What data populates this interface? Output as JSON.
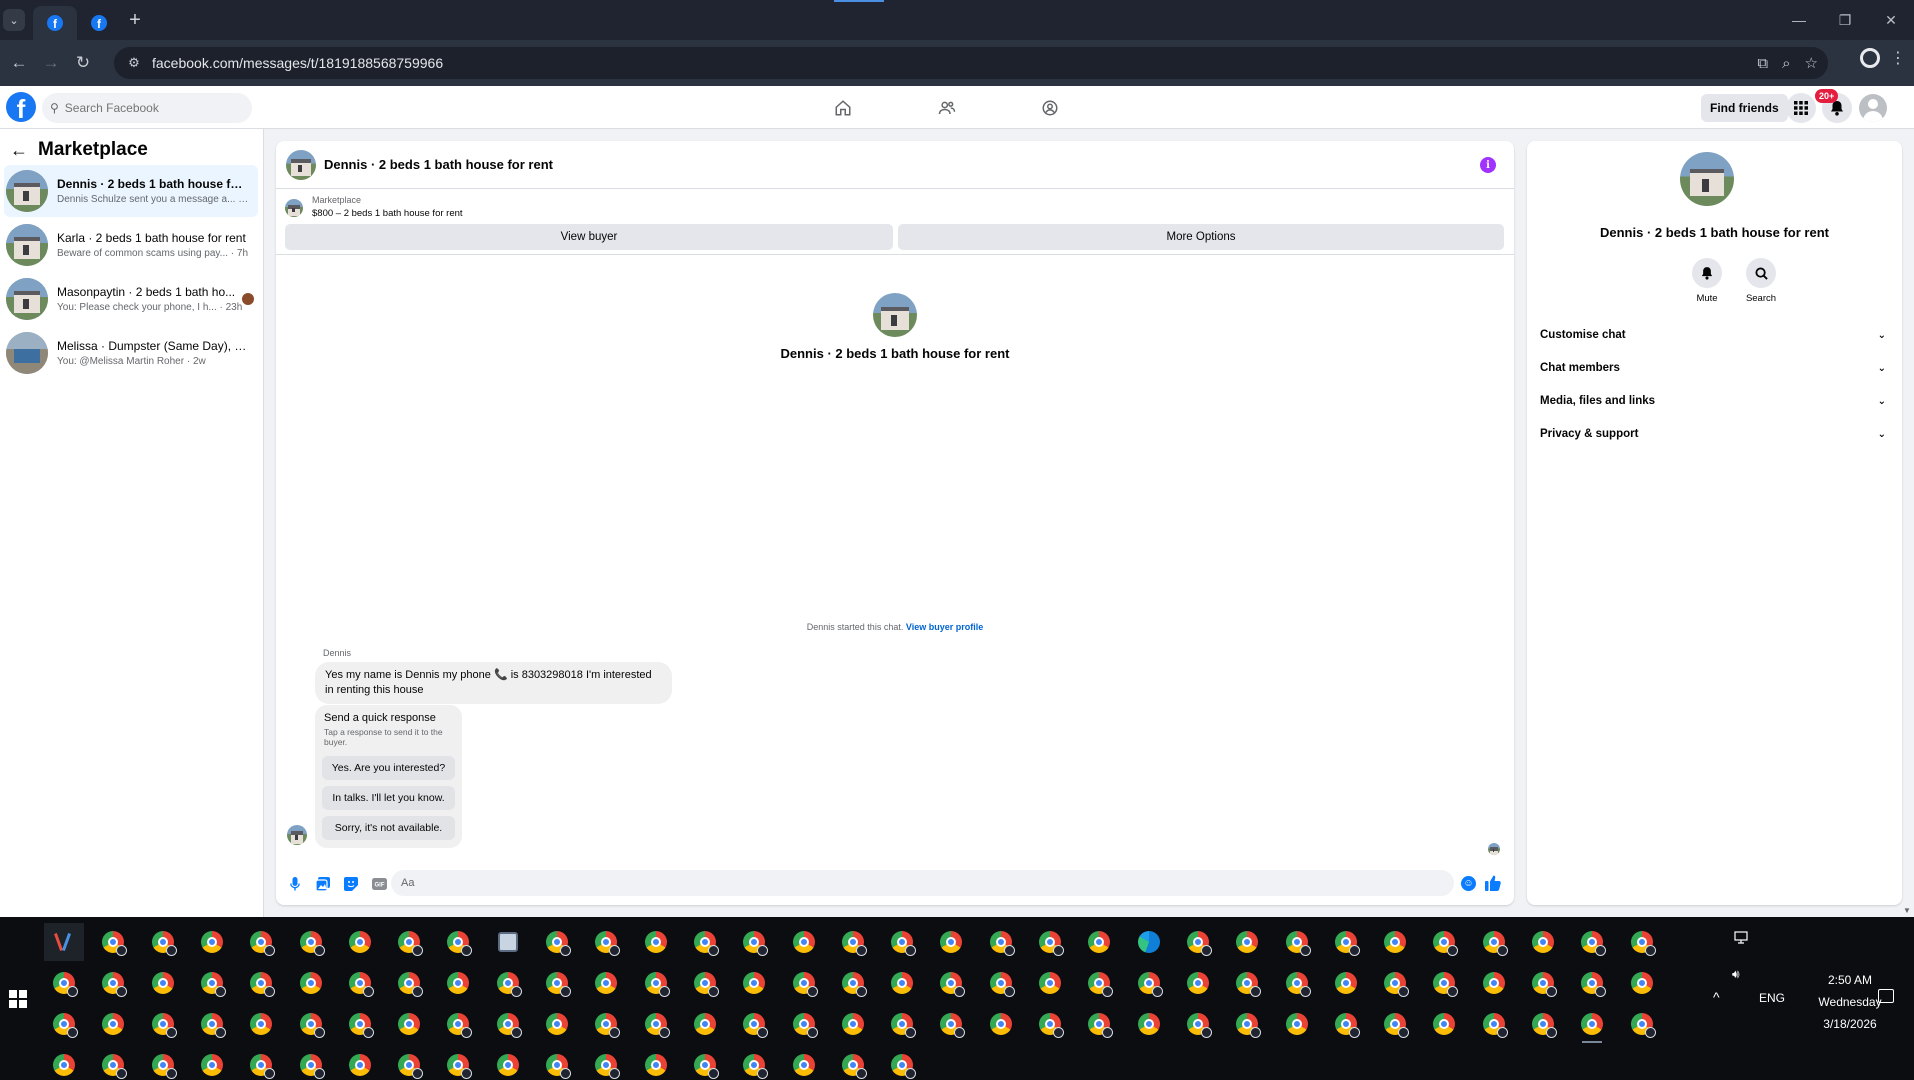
{
  "browser": {
    "tabs": [
      {
        "favicon": "facebook-icon",
        "active": true
      },
      {
        "favicon": "facebook-icon",
        "active": false
      }
    ],
    "url": "facebook.com/messages/t/1819188568759966"
  },
  "fb_header": {
    "search_placeholder": "Search Facebook",
    "find_friends_label": "Find friends",
    "notifications_badge": "20+"
  },
  "sidebar": {
    "title": "Marketplace",
    "conversations": [
      {
        "title": "Dennis · 2 beds 1 bath house for re...",
        "subtitle": "Dennis Schulze sent you a message a... · 4h",
        "selected": true
      },
      {
        "title": "Karla · 2 beds 1 bath house for rent",
        "subtitle": "Beware of common scams using pay... · 7h",
        "selected": false
      },
      {
        "title": "Masonpaytin · 2 beds 1 bath ho...",
        "subtitle": "You: Please check your phone, I h... · 23h",
        "selected": false
      },
      {
        "title": "Melissa · Dumpster (Same Day), Re...",
        "subtitle": "You: @Melissa Martin Roher · 2w",
        "selected": false
      }
    ]
  },
  "chat": {
    "title": "Dennis · 2 beds 1 bath house for rent",
    "marketplace_label": "Marketplace",
    "listing": "$800 – 2 beds 1 bath house for rent",
    "view_buyer_label": "View buyer",
    "more_options_label": "More Options",
    "profile_name": "Dennis · 2 beds 1 bath house for rent",
    "started_text": "Dennis started this chat.",
    "view_buyer_profile": "View buyer profile",
    "sender": "Dennis",
    "message": "Yes my name is Dennis my phone 📞 is 8303298018 I'm interested in renting this house",
    "quick_response": {
      "title": "Send a quick response",
      "subtitle": "Tap a response to send it to the buyer.",
      "options": [
        "Yes. Are you interested?",
        "In talks. I'll let you know.",
        "Sorry, it's not available."
      ]
    },
    "composer_placeholder": "Aa"
  },
  "info_panel": {
    "title": "Dennis · 2 beds 1 bath house for rent",
    "actions": [
      {
        "label": "Mute",
        "icon": "bell-icon"
      },
      {
        "label": "Search",
        "icon": "search-icon"
      }
    ],
    "sections": [
      "Customise chat",
      "Chat members",
      "Media, files and links",
      "Privacy & support"
    ]
  },
  "taskbar": {
    "language": "ENG",
    "time": "2:50 AM",
    "day": "Wednesday",
    "date": "3/18/2026"
  }
}
